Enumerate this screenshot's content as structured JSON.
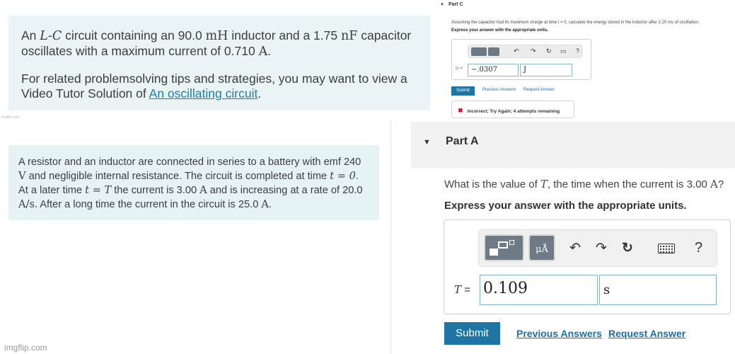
{
  "problem1": {
    "line1_pre": "An ",
    "circuit_symbol": "L-C",
    "line1_mid": " circuit containing an 90.0 ",
    "inductor_unit": "mH",
    "line1_mid2": " inductor and a 1.75 ",
    "capacitor_unit": "nF",
    "line1_post": " capacitor",
    "line2": "oscillates with a maximum current of 0.710 ",
    "current_unit": "A",
    "tips_pre": "For related problemsolving tips and strategies, you may want to view a Video Tutor Solution of ",
    "tips_link": "An oscillating circuit",
    "tips_post": "."
  },
  "watermark_small": "imgflip.com",
  "problem2": {
    "s1": "A resistor and an inductor are connected in series to a battery with emf 240 ",
    "u1": "V",
    "s2": " and negligible internal resistance. The circuit is completed at time ",
    "m1": "t = 0",
    "s3": ". At a later time ",
    "m2": "t = T",
    "s4": " the current is 3.00 ",
    "u2": "A",
    "s5": " and is increasing at a rate of 20.0 ",
    "u3": "A/s",
    "s6": ". After a long time the current in the circuit is 25.0 ",
    "u4": "A",
    "s7": "."
  },
  "watermark": "imgflip.com",
  "part_c": {
    "title": "Part C",
    "question": "Assuming the capacitor had its maximum charge at time t = 0, calculate the energy stored in the inductor after 2.20 ms of oscillation.",
    "express": "Express your answer with the appropriate units.",
    "var_label": "U =",
    "value": "−.0307",
    "unit": "J",
    "submit": "Submit",
    "previous": "Previous Answers",
    "request": "Request Answer",
    "feedback": "Incorrect; Try Again; 4 attempts remaining",
    "unit_button": "μÅ",
    "help": "?"
  },
  "part_a": {
    "title": "Part A",
    "question_pre": "What is the value of ",
    "question_var": "T",
    "question_post": ", the time when the current is 3.00 ",
    "question_unit": "A",
    "question_end": "?",
    "express": "Express your answer with the appropriate units.",
    "var_label": "T",
    "equals": "=",
    "value": "0.109",
    "unit": "s",
    "submit": "Submit",
    "previous": "Previous Answers",
    "request": "Request Answer",
    "unit_button": "μÅ",
    "help": "?"
  }
}
